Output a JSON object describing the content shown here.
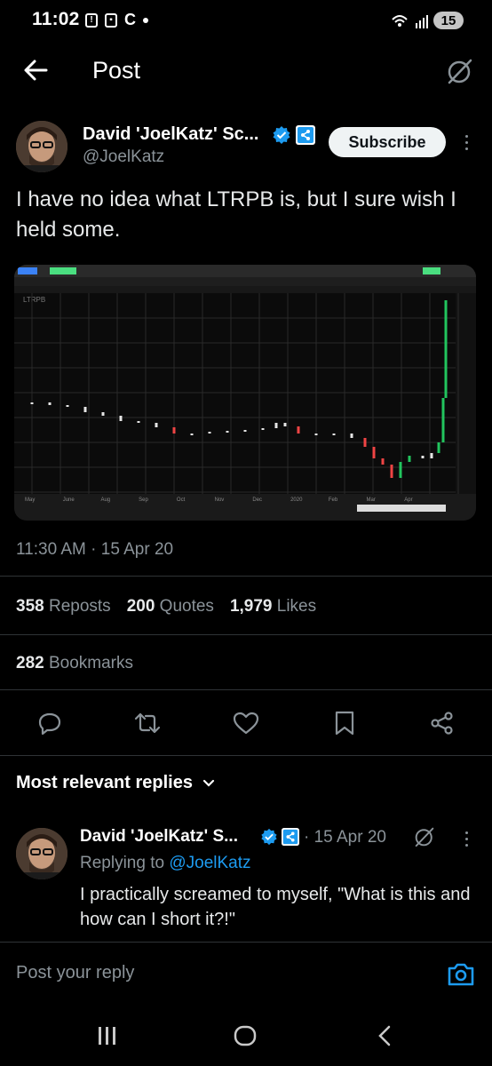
{
  "status_bar": {
    "time": "11:02",
    "battery": "15"
  },
  "header": {
    "title": "Post"
  },
  "post": {
    "author_name": "David 'JoelKatz' Sc...",
    "author_handle": "@JoelKatz",
    "subscribe_label": "Subscribe",
    "text": "I have no idea what LTRPB is, but I sure wish I held some.",
    "timestamp": "11:30 AM · 15 Apr 20",
    "reposts_count": "358",
    "reposts_label": "Reposts",
    "quotes_count": "200",
    "quotes_label": "Quotes",
    "likes_count": "1,979",
    "likes_label": "Likes",
    "bookmarks_count": "282",
    "bookmarks_label": "Bookmarks"
  },
  "chart": {
    "symbol": "LTRPB",
    "months": [
      "May",
      "June",
      "Aug",
      "Sep",
      "Oct",
      "Nov",
      "Dec",
      "2020",
      "Feb",
      "Mar",
      "Apr"
    ],
    "colors": {
      "up": "#22c55e",
      "down": "#ef4444",
      "flat": "#e5e5e5"
    }
  },
  "replies": {
    "section_title": "Most relevant replies",
    "items": [
      {
        "author_name": "David 'JoelKatz' S...",
        "date": "· 15 Apr 20",
        "replying_prefix": "Replying to",
        "replying_handle": "@JoelKatz",
        "text": "I practically screamed to myself, \"What is this and how can I short it?!\""
      }
    ]
  },
  "composer": {
    "placeholder": "Post your reply"
  },
  "theme": {
    "accent": "#1d9bf0",
    "background": "#000000",
    "muted": "#8b9399"
  },
  "icons": [
    "back-arrow-icon",
    "grok-icon",
    "verified-icon",
    "xrp-icon",
    "more-icon",
    "reply-icon",
    "repost-icon",
    "like-icon",
    "bookmark-icon",
    "share-icon",
    "chevron-down-icon",
    "camera-icon"
  ]
}
